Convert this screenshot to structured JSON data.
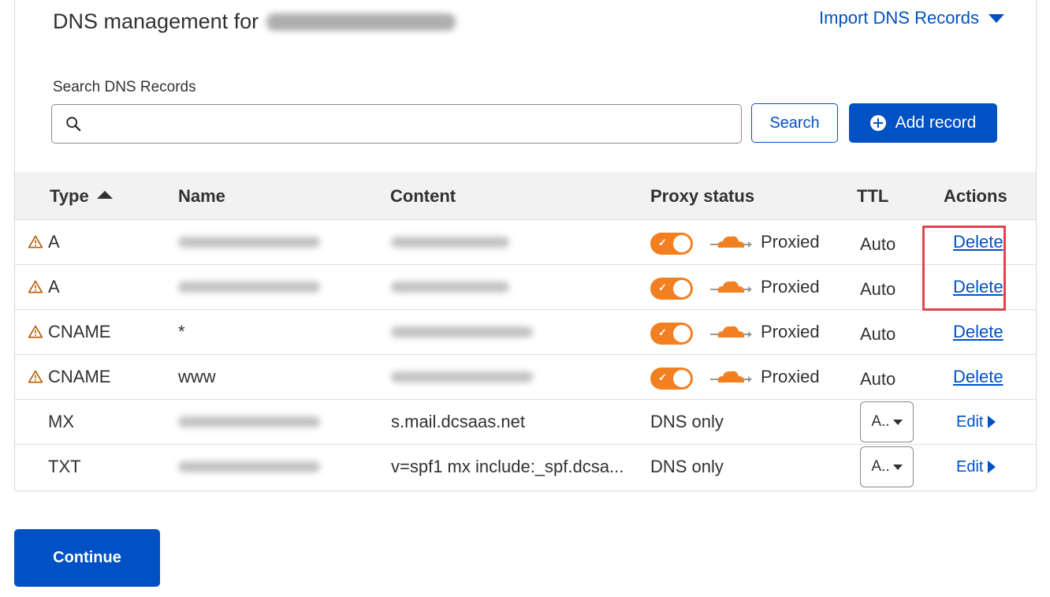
{
  "header": {
    "title_prefix": "DNS management for",
    "import_label": "Import DNS Records"
  },
  "search": {
    "label": "Search DNS Records",
    "value": "",
    "placeholder": "",
    "button_label": "Search"
  },
  "add_record_label": "Add record",
  "table": {
    "columns": {
      "type": "Type",
      "name": "Name",
      "content": "Content",
      "proxy": "Proxy status",
      "ttl": "TTL",
      "actions": "Actions"
    },
    "rows": [
      {
        "type": "A",
        "name": "",
        "content": "",
        "proxy": "Proxied",
        "ttl": "Auto",
        "action": "Delete"
      },
      {
        "type": "A",
        "name": "",
        "content": "",
        "proxy": "Proxied",
        "ttl": "Auto",
        "action": "Delete"
      },
      {
        "type": "CNAME",
        "name": "*",
        "content": "",
        "proxy": "Proxied",
        "ttl": "Auto",
        "action": "Delete"
      },
      {
        "type": "CNAME",
        "name": "www",
        "content": "",
        "proxy": "Proxied",
        "ttl": "Auto",
        "action": "Delete"
      },
      {
        "type": "MX",
        "name": "",
        "content": "s.mail.dcsaas.net",
        "proxy": "DNS only",
        "ttl": "A..",
        "action": "Edit"
      },
      {
        "type": "TXT",
        "name": "",
        "content": "v=spf1 mx include:_spf.dcsa...",
        "proxy": "DNS only",
        "ttl": "A..",
        "action": "Edit"
      }
    ]
  },
  "continue_label": "Continue",
  "colors": {
    "accent": "#0051c3",
    "proxy_orange": "#f38020",
    "warning": "#b85c00",
    "highlight": "#e0454f"
  }
}
